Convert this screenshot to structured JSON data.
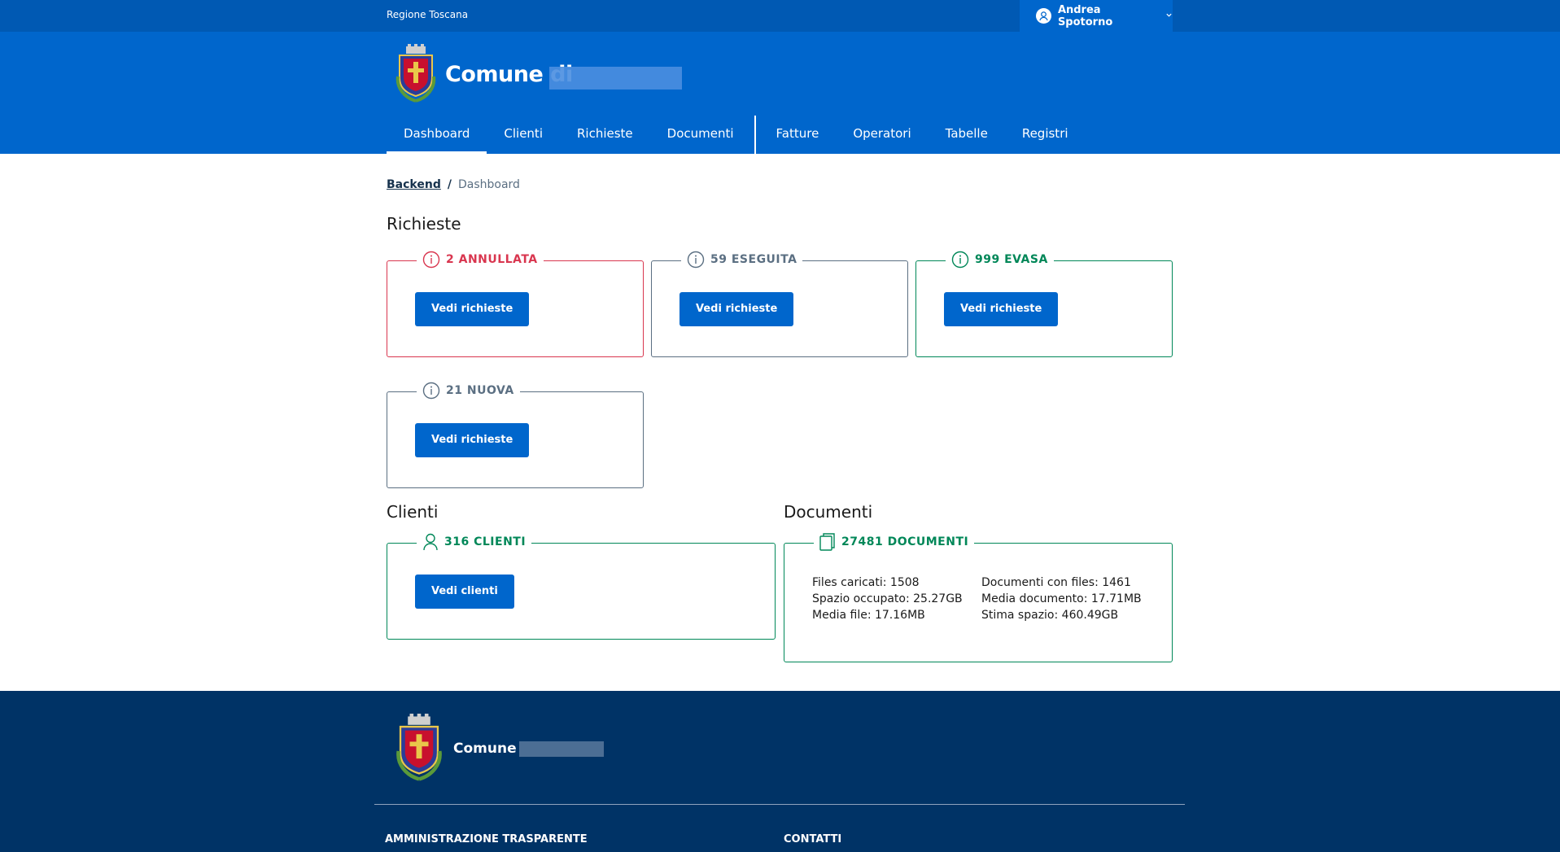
{
  "topbar": {
    "region": "Regione Toscana",
    "user_name": "Andrea Spotorno"
  },
  "header": {
    "title": "Comune di"
  },
  "nav": {
    "items": [
      "Dashboard",
      "Clienti",
      "Richieste",
      "Documenti",
      "Fatture",
      "Operatori",
      "Tabelle",
      "Registri"
    ],
    "active": "Dashboard"
  },
  "breadcrumb": {
    "root": "Backend",
    "current": "Dashboard"
  },
  "richieste": {
    "title": "Richieste",
    "cards": [
      {
        "label": "2 ANNULLATA",
        "button": "Vedi richieste",
        "color": "#d9364f"
      },
      {
        "label": "59 ESEGUITA",
        "button": "Vedi richieste",
        "color": "#5b6f82"
      },
      {
        "label": "999 EVASA",
        "button": "Vedi richieste",
        "color": "#008758"
      },
      {
        "label": "21 NUOVA",
        "button": "Vedi richieste",
        "color": "#5b6f82"
      }
    ]
  },
  "clienti": {
    "title": "Clienti",
    "label": "316 CLIENTI",
    "button": "Vedi clienti"
  },
  "documenti": {
    "title": "Documenti",
    "label": "27481 DOCUMENTI",
    "stats": [
      "Files caricati: 1508",
      "Documenti con files: 1461",
      "Spazio occupato: 25.27GB",
      "Media documento: 17.71MB",
      "Media file: 17.16MB",
      "Stima spazio: 460.49GB"
    ]
  },
  "footer": {
    "title": "Comune di",
    "col1": "AMMINISTRAZIONE TRASPARENTE",
    "col2": "CONTATTI"
  },
  "colors": {
    "topbar": "#0059b3",
    "header": "#0066cc",
    "footer": "#003366",
    "danger": "#d9364f",
    "success": "#008758",
    "neutral": "#5b6f82"
  }
}
